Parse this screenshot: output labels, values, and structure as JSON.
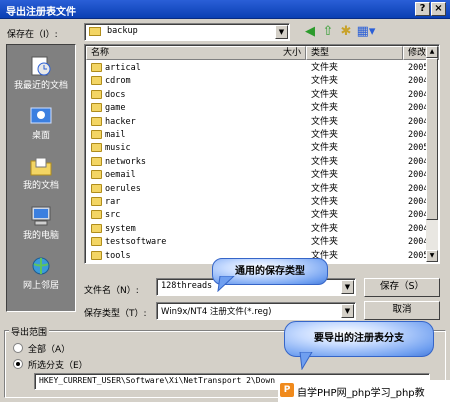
{
  "window": {
    "title": "导出注册表文件",
    "help_glyph": "?",
    "close_glyph": "×"
  },
  "save_in": {
    "label": "保存在（I）:",
    "value": "backup"
  },
  "toolbar_icons": [
    "back-icon",
    "up-folder-icon",
    "new-folder-icon",
    "view-menu-icon"
  ],
  "places": [
    {
      "label": "我最近的文档",
      "icon": "recent-documents-icon"
    },
    {
      "label": "桌面",
      "icon": "desktop-icon"
    },
    {
      "label": "我的文档",
      "icon": "my-documents-icon"
    },
    {
      "label": "我的电脑",
      "icon": "my-computer-icon"
    },
    {
      "label": "网上邻居",
      "icon": "network-places-icon"
    }
  ],
  "columns": {
    "name": "名称",
    "size": "大小",
    "type": "类型",
    "modified": "修改"
  },
  "files": [
    {
      "name": "artical",
      "type": "文件夹",
      "date": "2005-"
    },
    {
      "name": "cdrom",
      "type": "文件夹",
      "date": "2004-"
    },
    {
      "name": "docs",
      "type": "文件夹",
      "date": "2004-"
    },
    {
      "name": "game",
      "type": "文件夹",
      "date": "2004-"
    },
    {
      "name": "hacker",
      "type": "文件夹",
      "date": "2004-"
    },
    {
      "name": "mail",
      "type": "文件夹",
      "date": "2004-"
    },
    {
      "name": "music",
      "type": "文件夹",
      "date": "2005-"
    },
    {
      "name": "networks",
      "type": "文件夹",
      "date": "2004-"
    },
    {
      "name": "oemail",
      "type": "文件夹",
      "date": "2004-"
    },
    {
      "name": "oerules",
      "type": "文件夹",
      "date": "2004-"
    },
    {
      "name": "rar",
      "type": "文件夹",
      "date": "2004-"
    },
    {
      "name": "src",
      "type": "文件夹",
      "date": "2004-"
    },
    {
      "name": "system",
      "type": "文件夹",
      "date": "2004-"
    },
    {
      "name": "testsoftware",
      "type": "文件夹",
      "date": "2004-"
    },
    {
      "name": "tools",
      "type": "文件夹",
      "date": "2005-"
    }
  ],
  "filename": {
    "label": "文件名（N）:",
    "value": "128threads"
  },
  "filetype": {
    "label": "保存类型（T）:",
    "value": "Win9x/NT4 注册文件(*.reg)"
  },
  "buttons": {
    "save": "保存（S）",
    "cancel": "取消"
  },
  "callouts": {
    "type_note": "通用的保存类型",
    "branch_note": "要导出的注册表分支"
  },
  "export_range": {
    "group_label": "导出范围",
    "all": "全部（A）",
    "branch": "所选分支（E）",
    "branch_path": "HKEY_CURRENT_USER\\Software\\Xi\\NetTransport 2\\Down"
  },
  "watermark": "自学PHP网_php学习_php教",
  "colors": {
    "titlebar": "#0a3fb3",
    "dialog": "#d4d0c8",
    "places_bg": "#808080",
    "folder": "#f3d564",
    "callout": "#6f9ff0"
  }
}
